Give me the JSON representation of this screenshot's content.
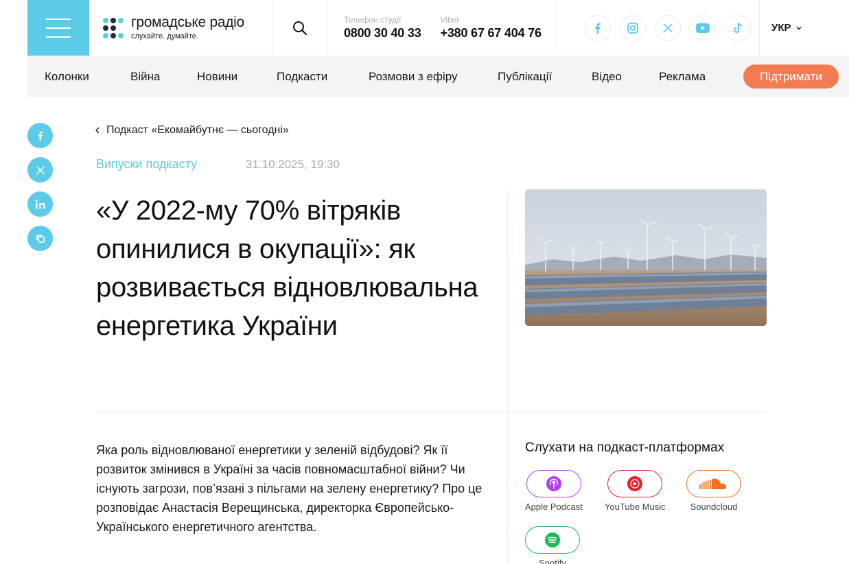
{
  "header": {
    "logo_name": "громадське радіо",
    "logo_slogan": "слухайте. думайте.",
    "phones": [
      {
        "caption": "Телефон студії",
        "number": "0800 30 40 33"
      },
      {
        "caption": "Viber",
        "number": "+380 67 67 404 76"
      }
    ],
    "socials": [
      "facebook-icon",
      "instagram-icon",
      "x-icon",
      "youtube-icon",
      "tiktok-icon"
    ],
    "language": "УКР"
  },
  "nav": {
    "items": [
      "Колонки",
      "Війна",
      "Новини",
      "Подкасти",
      "Розмови з ефіру",
      "Публікації",
      "Відео",
      "Реклама"
    ],
    "support_label": "Підтримати"
  },
  "article": {
    "breadcrumb": "Подкаст «Екомайбутнє — сьогодні»",
    "category": "Випуски подкасту",
    "date": "31.10.2025, 19:30",
    "title": "«У 2022-му 70% вітряків опинилися в окупації»: як розвивається відновлювальна енергетика України",
    "lead": "Яка роль відновлюваної енергетики у зеленій відбудові? Як її розвиток змінився в Україні за часів повномасштабної війни? Чи існують загрози, пов’язані з пільгами на зелену енергетику? Про це розповідає Анастасія Верещинська, директорка Європейсько-Українського енергетичного агентства."
  },
  "listen": {
    "title": "Слухати на подкаст-платформах",
    "platforms": [
      {
        "label": "Apple Podcast",
        "icon": "apple-podcast-icon",
        "color": "#b33df0"
      },
      {
        "label": "YouTube Music",
        "icon": "youtube-music-icon",
        "color": "#e5202e"
      },
      {
        "label": "Soundcloud",
        "icon": "soundcloud-icon",
        "color": "#f26f23"
      },
      {
        "label": "Spotify",
        "icon": "spotify-icon",
        "color": "#1db954"
      }
    ]
  },
  "colors": {
    "accent": "#5ccbe8",
    "support": "#f37b52"
  }
}
